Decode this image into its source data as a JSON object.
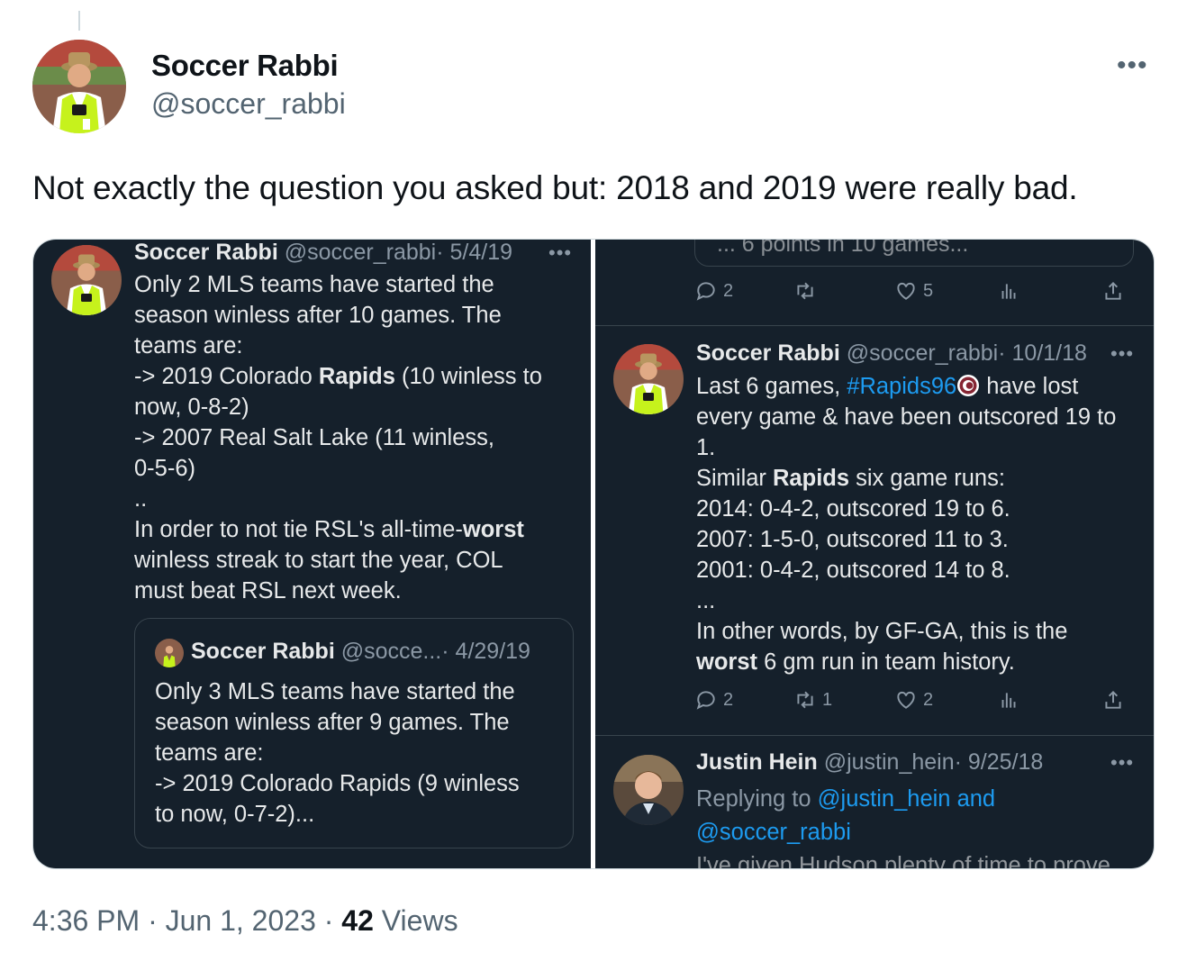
{
  "tweet": {
    "author_name": "Soccer Rabbi",
    "author_handle": "@soccer_rabbi",
    "text": "Not exactly the question you asked but: 2018 and 2019 were really bad.",
    "time": "4:36 PM",
    "sep": "·",
    "date": "Jun 1, 2023",
    "views_count": "42",
    "views_label": "Views"
  },
  "left": {
    "name": "Soccer Rabbi",
    "handle": "@soccer_rabbi",
    "date": "· 5/4/19",
    "line1": "Only 2 MLS teams have started the",
    "line2": "season winless after 10 games. The",
    "line3": "teams are:",
    "line4a": "-> 2019 Colorado ",
    "line4b": "Rapids",
    "line4c": " (10 winless to",
    "line5": "now, 0-8-2)",
    "line6": "-> 2007 Real Salt Lake (11 winless,",
    "line7": "0-5-6)",
    "line8": "..",
    "line9a": "In order to not tie RSL's all-time-",
    "line9b": "worst",
    "line10": "winless streak to start the year, COL",
    "line11": "must beat RSL next week.",
    "quote": {
      "name": "Soccer Rabbi",
      "handle": "@socce...",
      "date": "· 4/29/19",
      "line1": "Only 3 MLS teams have started the",
      "line2": "season winless after 9 games. The",
      "line3": "teams are:",
      "line4": "-> 2019 Colorado Rapids (9 winless",
      "line5": "to now, 0-7-2)..."
    }
  },
  "right": {
    "top_actions": {
      "reply": "2",
      "retweet": "",
      "like": "5"
    },
    "cut_text": "... 6 points in 10 games...",
    "t1": {
      "name": "Soccer Rabbi",
      "handle": "@soccer_rabbi",
      "date": "· 10/1/18",
      "line1a": "Last 6 games, ",
      "hashtag": "#Rapids96",
      "line1b": " have lost",
      "line2": "every game & have been outscored 19 to",
      "line3": "1.",
      "line4a": "Similar ",
      "line4b": "Rapids",
      "line4c": " six game runs:",
      "line5": "2014: 0-4-2, outscored 19 to 6.",
      "line6": "2007: 1-5-0, outscored 11 to 3.",
      "line7": "2001: 0-4-2, outscored 14 to 8.",
      "line8": "...",
      "line9": "In other words, by GF-GA, this is the",
      "line10a": "worst",
      "line10b": " 6 gm run in team history.",
      "actions": {
        "reply": "2",
        "retweet": "1",
        "like": "2"
      }
    },
    "t2": {
      "name": "Justin Hein",
      "handle": "@justin_hein",
      "date": "· 9/25/18",
      "replying": "Replying to ",
      "mention1": "@justin_hein and",
      "mention2": "@soccer_rabbi",
      "cut": "I've given Hudson plenty of time to prove"
    }
  },
  "colors": {
    "panel_bg": "#15202b",
    "link": "#1d9bf0",
    "muted": "#8b98a5",
    "vest": "#c6f21c"
  }
}
